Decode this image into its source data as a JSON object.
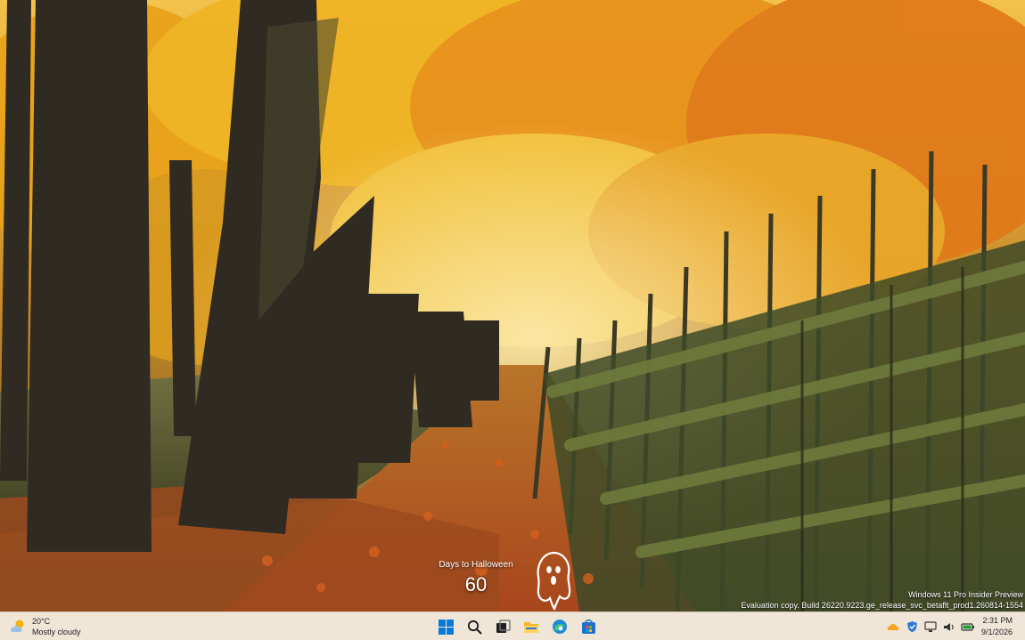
{
  "widget": {
    "label": "Days to Halloween",
    "days": "60"
  },
  "watermark": {
    "line1": "Windows 11 Pro Insider Preview",
    "line2": "Evaluation copy. Build 26220.9223.ge_release_svc_betaflt_prod1.260814-1554"
  },
  "taskbar": {
    "weather": {
      "temp": "20°C",
      "condition": "Mostly cloudy",
      "icon": "partly-cloudy-icon"
    },
    "apps": [
      {
        "name": "start-button",
        "icon": "windows-logo-icon"
      },
      {
        "name": "search-button",
        "icon": "search-icon"
      },
      {
        "name": "task-view-button",
        "icon": "task-view-icon"
      },
      {
        "name": "file-explorer-button",
        "icon": "folder-icon"
      },
      {
        "name": "edge-button",
        "icon": "edge-icon"
      },
      {
        "name": "store-button",
        "icon": "store-icon"
      }
    ],
    "tray": [
      "onedrive-icon",
      "security-icon",
      "network-icon",
      "volume-icon",
      "battery-icon"
    ],
    "clock": {
      "time": "2:31 PM",
      "date": "9/1/2026"
    }
  },
  "colors": {
    "taskbar_bg": "#efe6d8",
    "accent_blue": "#0078d4"
  }
}
